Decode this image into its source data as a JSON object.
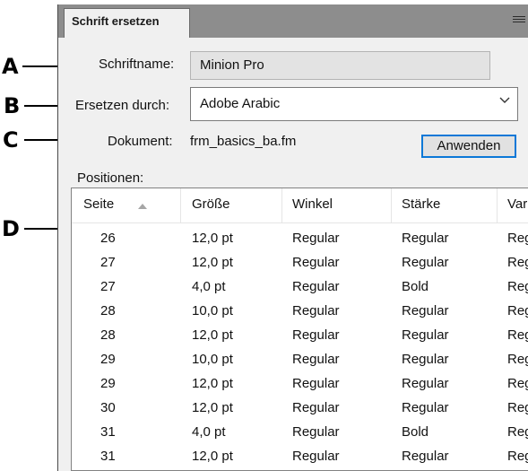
{
  "callouts": [
    "A",
    "B",
    "C",
    "D"
  ],
  "panel": {
    "tab_title": "Schrift ersetzen"
  },
  "form": {
    "font_name_label": "Schriftname:",
    "font_name_value": "Minion Pro",
    "replace_label": "Ersetzen durch:",
    "replace_value": "Adobe Arabic",
    "document_label": "Dokument:",
    "document_value": "frm_basics_ba.fm",
    "apply_label": "Anwenden"
  },
  "positions": {
    "label": "Positionen:",
    "sort_column": "Seite",
    "sort_direction": "ascending",
    "columns": [
      "Seite",
      "Größe",
      "Winkel",
      "Stärke",
      "Var"
    ],
    "rows": [
      [
        "26",
        "12,0 pt",
        "Regular",
        "Regular",
        "Reg"
      ],
      [
        "27",
        "12,0 pt",
        "Regular",
        "Regular",
        "Reg"
      ],
      [
        "27",
        "4,0 pt",
        "Regular",
        "Bold",
        "Reg"
      ],
      [
        "28",
        "10,0 pt",
        "Regular",
        "Regular",
        "Reg"
      ],
      [
        "28",
        "12,0 pt",
        "Regular",
        "Regular",
        "Reg"
      ],
      [
        "29",
        "10,0 pt",
        "Regular",
        "Regular",
        "Reg"
      ],
      [
        "29",
        "12,0 pt",
        "Regular",
        "Regular",
        "Reg"
      ],
      [
        "30",
        "12,0 pt",
        "Regular",
        "Regular",
        "Reg"
      ],
      [
        "31",
        "4,0 pt",
        "Regular",
        "Bold",
        "Reg"
      ],
      [
        "31",
        "12,0 pt",
        "Regular",
        "Regular",
        "Reg"
      ]
    ]
  },
  "colors": {
    "accent": "#0b78d7",
    "titlebar": "#8d8d8d",
    "panel_bg": "#f0f0f0"
  }
}
